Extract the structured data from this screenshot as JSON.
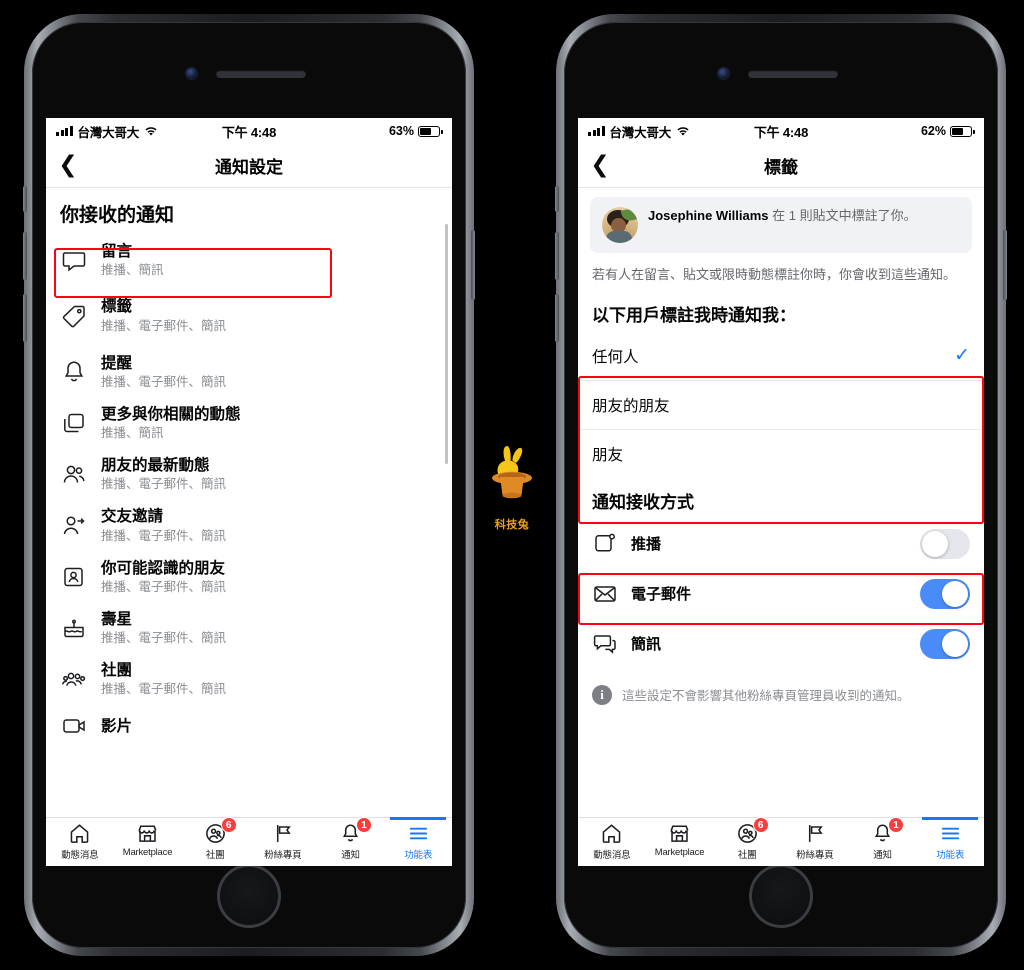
{
  "status_bar_left": {
    "carrier": "台灣大哥大",
    "time": "下午 4:48",
    "battery_left": "63%",
    "battery_right": "62%"
  },
  "left_phone": {
    "nav": {
      "back_icon": "chevron-left",
      "title": "通知設定"
    },
    "section_title": "你接收的通知",
    "items": [
      {
        "icon": "comment-icon",
        "title": "留言",
        "subtitle": "推播、簡訊"
      },
      {
        "icon": "tag-icon",
        "title": "標籤",
        "subtitle": "推播、電子郵件、簡訊",
        "highlighted": true
      },
      {
        "icon": "bell-icon",
        "title": "提醒",
        "subtitle": "推播、電子郵件、簡訊"
      },
      {
        "icon": "copies-icon",
        "title": "更多與你相關的動態",
        "subtitle": "推播、簡訊"
      },
      {
        "icon": "friends-icon",
        "title": "朋友的最新動態",
        "subtitle": "推播、電子郵件、簡訊"
      },
      {
        "icon": "friend-request-icon",
        "title": "交友邀請",
        "subtitle": "推播、電子郵件、簡訊"
      },
      {
        "icon": "contact-card-icon",
        "title": "你可能認識的朋友",
        "subtitle": "推播、電子郵件、簡訊"
      },
      {
        "icon": "cake-icon",
        "title": "壽星",
        "subtitle": "推播、電子郵件、簡訊"
      },
      {
        "icon": "group-icon",
        "title": "社團",
        "subtitle": "推播、電子郵件、簡訊"
      },
      {
        "icon": "video-icon",
        "title": "影片",
        "subtitle": ""
      }
    ]
  },
  "right_phone": {
    "nav": {
      "back_icon": "chevron-left",
      "title": "標籤"
    },
    "banner": {
      "avatar": "user-avatar",
      "name": "Josephine Williams",
      "rest": " 在 1 則貼文中標註了你。"
    },
    "description": "若有人在留言、貼文或限時動態標註你時，你會收到這些通知。",
    "section_heading": "以下用戶標註我時通知我：",
    "options": [
      {
        "label": "任何人",
        "selected": true
      },
      {
        "label": "朋友的朋友",
        "selected": false
      },
      {
        "label": "朋友",
        "selected": false
      }
    ],
    "methods_heading": "通知接收方式",
    "methods": [
      {
        "icon": "push-icon",
        "label": "推播",
        "on": false,
        "highlighted": true
      },
      {
        "icon": "email-icon",
        "label": "電子郵件",
        "on": true
      },
      {
        "icon": "sms-icon",
        "label": "簡訊",
        "on": true
      }
    ],
    "info_note": "這些設定不會影響其他粉絲專頁管理員收到的通知。"
  },
  "tabbar": [
    {
      "icon": "home-icon",
      "label": "動態消息",
      "badge": "",
      "active": false
    },
    {
      "icon": "marketplace-icon",
      "label": "Marketplace",
      "badge": "",
      "active": false
    },
    {
      "icon": "groups-icon",
      "label": "社團",
      "badge": "6",
      "active": false
    },
    {
      "icon": "pages-icon",
      "label": "粉絲專頁",
      "badge": "",
      "active": false
    },
    {
      "icon": "bell-icon",
      "label": "通知",
      "badge": "1",
      "active": false
    },
    {
      "icon": "menu-icon",
      "label": "功能表",
      "badge": "",
      "active": true
    }
  ],
  "watermark": {
    "logo": "rabbit-in-hat-logo",
    "label": "科技兔"
  },
  "colors": {
    "accent_blue": "#1877f2",
    "toggle_on": "#4a8cf7",
    "badge_red": "#fa3e3e",
    "highlight_red": "#ff0015",
    "muted_text": "#8a8d91"
  }
}
